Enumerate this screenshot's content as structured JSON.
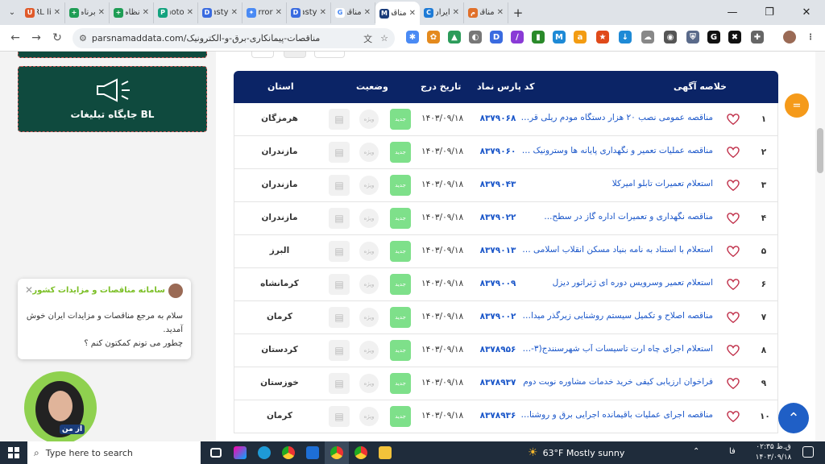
{
  "browser": {
    "tabs": [
      {
        "label": "URL li",
        "color": "#e05a2a",
        "glyph": "U"
      },
      {
        "label": "برنامه",
        "color": "#1f9d55",
        "glyph": "+"
      },
      {
        "label": "نظام",
        "color": "#1f9d55",
        "glyph": "+"
      },
      {
        "label": "Photo",
        "color": "#14a37f",
        "glyph": "P"
      },
      {
        "label": "Dasty",
        "color": "#3a6be0",
        "glyph": "D"
      },
      {
        "label": "Error",
        "color": "#4a8af4",
        "glyph": "✦"
      },
      {
        "label": "Dasty",
        "color": "#3a6be0",
        "glyph": "D"
      },
      {
        "label": "مناقص",
        "color": "#ffffff",
        "glyph": "G"
      },
      {
        "label": "مناقص",
        "color": "#1a3c7a",
        "glyph": "M",
        "active": true
      },
      {
        "label": "ایران",
        "color": "#1e7bd6",
        "glyph": "C"
      },
      {
        "label": "مناقص",
        "color": "#e0702a",
        "glyph": "م"
      }
    ],
    "url": "parsnamaddata.com/مناقصات-پیمانکاری-برق-و-الکترونیک"
  },
  "sidebar": {
    "ad_label": "جایگاه تبلیغات BL"
  },
  "chat": {
    "title": "سامانه مناقصات و مزایدات کشور",
    "message": "سلام به مرجع مناقصات و مزایدات ایران خوش آمدید.\nچطور می تونم کمکتون کنم ؟",
    "avatar_label": "از من"
  },
  "table": {
    "headers": {
      "summary": "خلاصه آگهی",
      "code": "کد پارس نماد",
      "date": "تاریخ درج",
      "status": "وضعیت",
      "province": "استان"
    },
    "badge_new": "جدید",
    "badge_view": "ویژه",
    "rows": [
      {
        "num": "۱",
        "title": "مناقصه عمومی  نصب ۲۰ هزار دستگاه مودم ریلی قرائ...",
        "code": "۸۳۷۹۰۶۸",
        "date": "۱۴۰۳/۰۹/۱۸",
        "province": "هرمزگان"
      },
      {
        "num": "۲",
        "title": "مناقصه عملیات تعمیر و نگهداری پایانه ها وسترونیک B...",
        "code": "۸۳۷۹۰۶۰",
        "date": "۱۴۰۳/۰۹/۱۸",
        "province": "مازندران"
      },
      {
        "num": "۳",
        "title": "استعلام تعمیرات تابلو امیرکلا",
        "code": "۸۳۷۹۰۴۳",
        "date": "۱۴۰۳/۰۹/۱۸",
        "province": "مازندران"
      },
      {
        "num": "۴",
        "title": "مناقصه نگهداری و تعمیرات اداره گاز در سطح...",
        "code": "۸۳۷۹۰۲۲",
        "date": "۱۴۰۳/۰۹/۱۸",
        "province": "مازندران"
      },
      {
        "num": "۵",
        "title": "استعلام با استناد به نامه بنیاد مسکن انقلاب اسلامی ش...",
        "code": "۸۳۷۹۰۱۳",
        "date": "۱۴۰۳/۰۹/۱۸",
        "province": "البرز"
      },
      {
        "num": "۶",
        "title": "استعلام تعمیر وسرویس دوره ای ژنراتور دیزل",
        "code": "۸۳۷۹۰۰۹",
        "date": "۱۴۰۳/۰۹/۱۸",
        "province": "کرمانشاه"
      },
      {
        "num": "۷",
        "title": "مناقصه اصلاح و تکمیل سیستم روشنایی زیرگذر میدان ...",
        "code": "۸۳۷۹۰۰۲",
        "date": "۱۴۰۳/۰۹/۱۸",
        "province": "کرمان"
      },
      {
        "num": "۸",
        "title": "استعلام اجرای چاه ارت تاسیسات آب شهرسنندج(۳-۹۹...",
        "code": "۸۳۷۸۹۵۶",
        "date": "۱۴۰۳/۰۹/۱۸",
        "province": "کردستان"
      },
      {
        "num": "۹",
        "title": "فراخوان ارزیابی کیفی خرید خدمات مشاوره  نوبت دوم",
        "code": "۸۳۷۸۹۳۷",
        "date": "۱۴۰۳/۰۹/۱۸",
        "province": "خوزستان"
      },
      {
        "num": "۱۰",
        "title": "مناقصه اجرای عملیات باقیمانده اجرایی برق و روشنایی ...",
        "code": "۸۳۷۸۹۳۶",
        "date": "۱۴۰۳/۰۹/۱۸",
        "province": "کرمان"
      }
    ]
  },
  "taskbar": {
    "search_placeholder": "Type here to search",
    "weather": "63°F  Mostly sunny",
    "lang": "فا",
    "time": "ق.ظ ۰۲:۳۵",
    "date": "۱۴۰۳/۰۹/۱۸"
  },
  "colors": {
    "header_bg": "#0b2466",
    "link": "#1a56c9",
    "badge_green": "#7ee08a",
    "ad_green": "#0f4a3e"
  }
}
